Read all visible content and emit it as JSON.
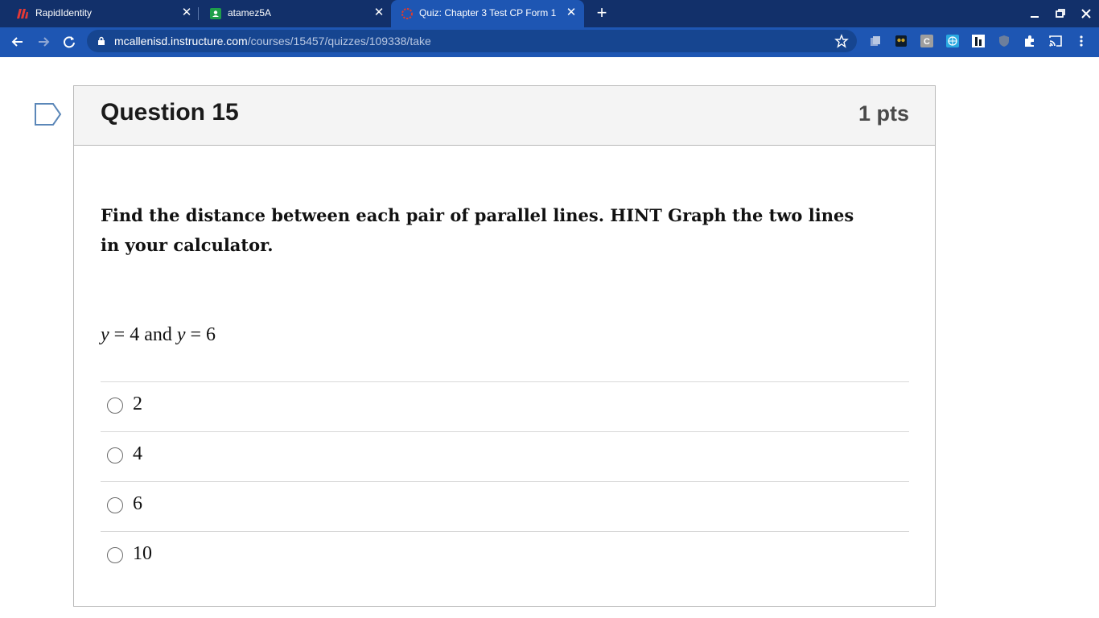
{
  "browser": {
    "tabs": [
      {
        "title": "RapidIdentity",
        "active": false
      },
      {
        "title": "atamez5A",
        "active": false
      },
      {
        "title": "Quiz: Chapter 3 Test CP Form 1",
        "active": true
      }
    ],
    "url_host": "mcallenisd.instructure.com",
    "url_path": "/courses/15457/quizzes/109338/take",
    "colors": {
      "tabstrip": "#12306a",
      "toolbar": "#1e56b3",
      "omnibox": "#164590"
    }
  },
  "question": {
    "title": "Question 15",
    "points": "1 pts",
    "prompt": "Find the distance between each pair of parallel lines. HINT Graph the two lines in your calculator.",
    "equation": {
      "var1": "y",
      "rel1": " = 4 and ",
      "var2": "y",
      "rel2": " = 6"
    },
    "answers": [
      {
        "label": "2"
      },
      {
        "label": "4"
      },
      {
        "label": "6"
      },
      {
        "label": "10"
      }
    ]
  }
}
